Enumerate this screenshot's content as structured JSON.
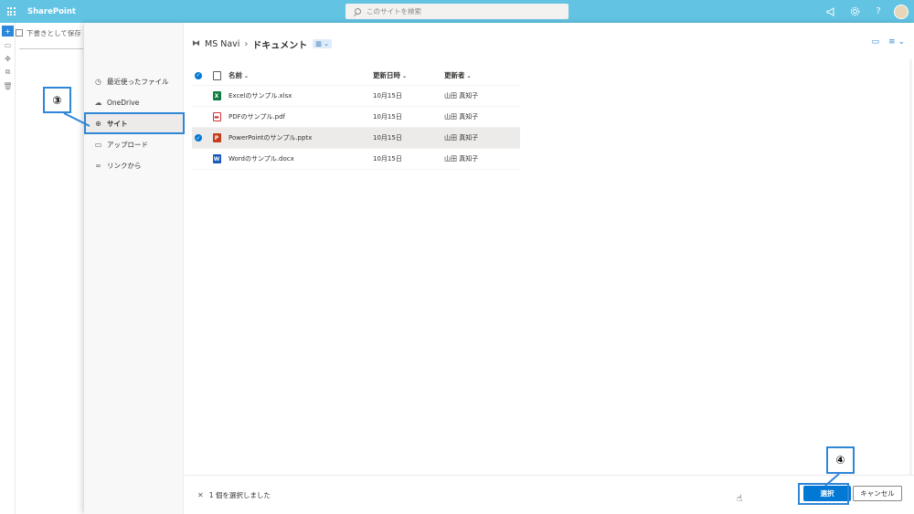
{
  "suite": {
    "app_name": "SharePoint",
    "search_placeholder": "このサイトを検索",
    "icons": [
      "megaphone-icon",
      "gear-icon",
      "help-icon"
    ],
    "help_glyph": "?"
  },
  "background_page": {
    "command_label": "下書きとして保存"
  },
  "nav": {
    "items": [
      {
        "label": "最近使ったファイル",
        "icon": "clock-icon"
      },
      {
        "label": "OneDrive",
        "icon": "cloud-icon"
      },
      {
        "label": "サイト",
        "icon": "globe-icon",
        "active": true
      },
      {
        "label": "アップロード",
        "icon": "upload-icon"
      },
      {
        "label": "リンクから",
        "icon": "link-icon"
      }
    ]
  },
  "breadcrumb": {
    "site": "MS Navi",
    "current": "ドキュメント"
  },
  "table": {
    "headers": {
      "name": "名前",
      "modified": "更新日時",
      "modified_by": "更新者"
    },
    "rows": [
      {
        "name": "Excelのサンプル.xlsx",
        "modified": "10月15日",
        "modified_by": "山田 真知子",
        "type": "xlsx",
        "selected": false
      },
      {
        "name": "PDFのサンプル.pdf",
        "modified": "10月15日",
        "modified_by": "山田 真知子",
        "type": "pdf",
        "selected": false
      },
      {
        "name": "PowerPointのサンプル.pptx",
        "modified": "10月15日",
        "modified_by": "山田 真知子",
        "type": "pptx",
        "selected": true
      },
      {
        "name": "Wordのサンプル.docx",
        "modified": "10月15日",
        "modified_by": "山田 真知子",
        "type": "docx",
        "selected": false
      }
    ]
  },
  "footer": {
    "selection_text": "1 個を選択しました",
    "select_button": "選択",
    "cancel_button": "キャンセル"
  },
  "callouts": {
    "step3": "③",
    "step4": "④"
  },
  "colors": {
    "suite_bar": "#62c3e3",
    "primary": "#0078d4",
    "callout_border": "#2f86d6"
  }
}
